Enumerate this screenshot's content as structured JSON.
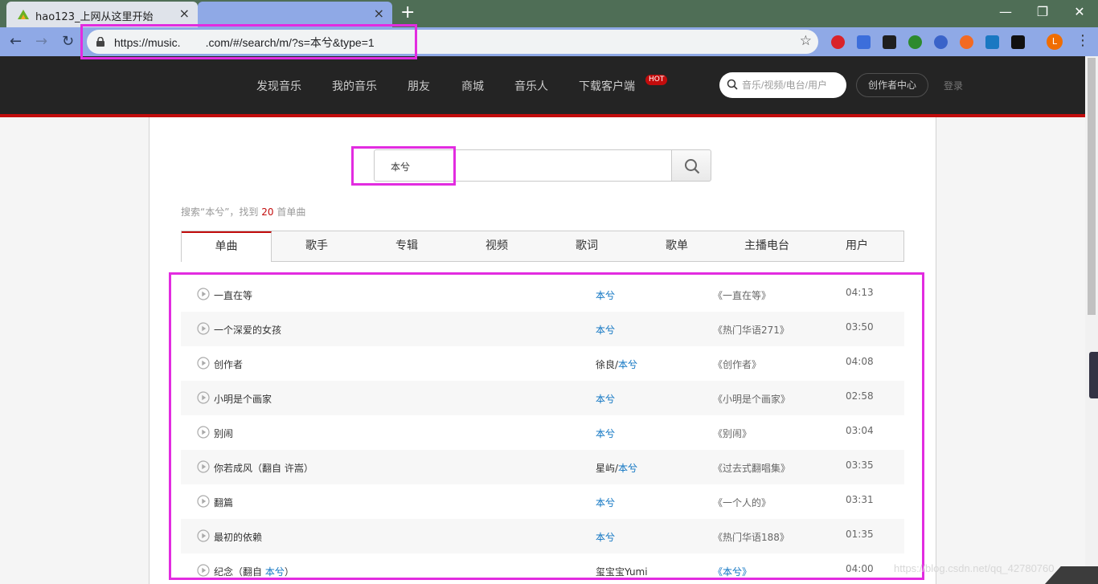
{
  "browser": {
    "tabs": [
      {
        "title": "hao123_上网从这里开始",
        "close": "×"
      },
      {
        "title": "",
        "close": "×"
      }
    ],
    "new_tab": "+",
    "window_controls": {
      "minimize": "—",
      "maximize": "❐",
      "close": "✕"
    },
    "nav": {
      "back": "←",
      "forward": "→",
      "reload": "↻"
    },
    "url": "https://music.        .com/#/search/m/?s=本兮&type=1",
    "bookmark_star": "☆",
    "profile_initial": "L",
    "menu": "⋮",
    "extension_colors": [
      "#d9232a",
      "#3c6edb",
      "#1f1f1f",
      "#2d8a2d",
      "#3a63c9",
      "#f36a22",
      "#1a78c2",
      "#111111"
    ]
  },
  "site": {
    "nav": [
      "发现音乐",
      "我的音乐",
      "朋友",
      "商城",
      "音乐人",
      "下载客户端"
    ],
    "hot_badge": "HOT",
    "search_placeholder": "音乐/视频/电台/用户",
    "creator_button": "创作者中心",
    "login": "登录"
  },
  "search": {
    "query": "本兮",
    "summary_prefix": "搜索“本兮”，找到 ",
    "summary_count": "20",
    "summary_suffix": " 首单曲"
  },
  "result_tabs": [
    "单曲",
    "歌手",
    "专辑",
    "视频",
    "歌词",
    "歌单",
    "主播电台",
    "用户"
  ],
  "active_tab": "单曲",
  "songs": [
    {
      "title": "一直在等",
      "title_link": "",
      "title_end": "",
      "artist_plain": "",
      "artist_link": "本兮",
      "album": "《一直在等》",
      "duration": "04:13"
    },
    {
      "title": "一个深爱的女孩",
      "title_link": "",
      "title_end": "",
      "artist_plain": "",
      "artist_link": "本兮",
      "album": "《热门华语271》",
      "duration": "03:50"
    },
    {
      "title": "创作者",
      "title_link": "",
      "title_end": "",
      "artist_plain": "徐良/",
      "artist_link": "本兮",
      "album": "《创作者》",
      "duration": "04:08"
    },
    {
      "title": "小明是个画家",
      "title_link": "",
      "title_end": "",
      "artist_plain": "",
      "artist_link": "本兮",
      "album": "《小明是个画家》",
      "duration": "02:58"
    },
    {
      "title": "别闹",
      "title_link": "",
      "title_end": "",
      "artist_plain": "",
      "artist_link": "本兮",
      "album": "《别闹》",
      "duration": "03:04"
    },
    {
      "title": "你若成风（翻自 许嵩）",
      "title_link": "",
      "title_end": "",
      "artist_plain": "星屿/",
      "artist_link": "本兮",
      "album": "《过去式翻唱集》",
      "duration": "03:35"
    },
    {
      "title": "翻篇",
      "title_link": "",
      "title_end": "",
      "artist_plain": "",
      "artist_link": "本兮",
      "album": "《一个人的》",
      "duration": "03:31"
    },
    {
      "title": "最初的依赖",
      "title_link": "",
      "title_end": "",
      "artist_plain": "",
      "artist_link": "本兮",
      "album": "《热门华语188》",
      "duration": "01:35"
    },
    {
      "title": "纪念（翻自 ",
      "title_link": "本兮",
      "title_end": "）",
      "artist_plain": "玺宝宝Yumi",
      "artist_link": "",
      "album": "《本兮》",
      "duration": "04:00"
    }
  ],
  "watermark": "https://blog.csdn.net/qq_42780760",
  "colors": {
    "accent_red": "#c20c0c",
    "link_blue": "#0c73c2",
    "annotation_magenta": "#e22ce0"
  }
}
